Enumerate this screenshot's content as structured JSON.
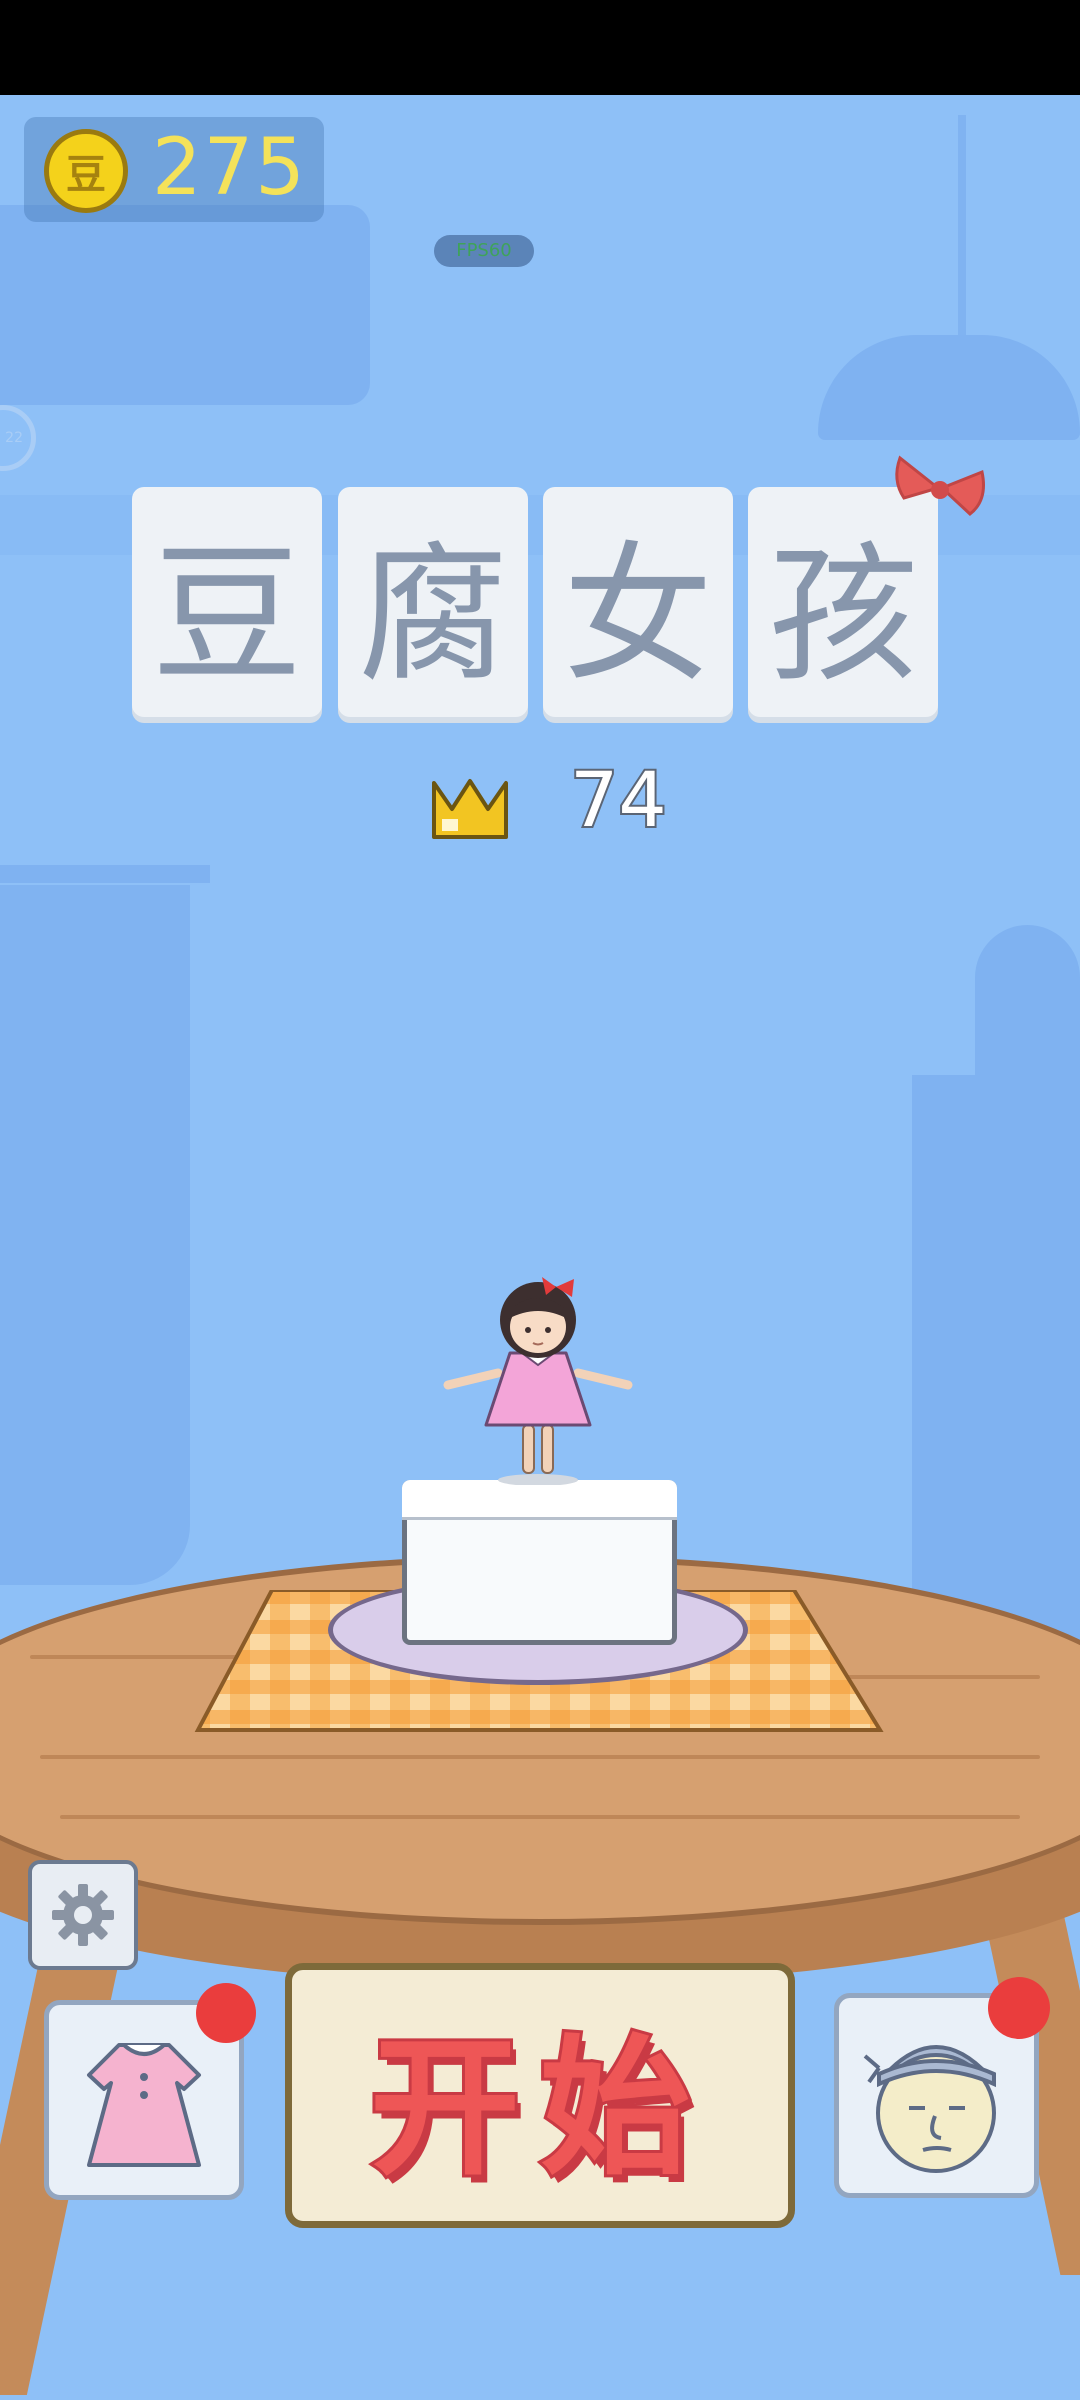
{
  "hud": {
    "coin_icon_char": "豆",
    "coins": "275",
    "fps": "FPS60",
    "side_indicator": "22"
  },
  "title": {
    "chars": [
      "豆",
      "腐",
      "女",
      "孩"
    ]
  },
  "best": {
    "icon": "crown-icon",
    "score": "74"
  },
  "buttons": {
    "start_label": "开始",
    "settings_icon": "gear-icon",
    "outfit_icon": "dress-icon",
    "boss_icon": "old-man-icon"
  },
  "colors": {
    "background": "#8ec0f7",
    "coin": "#f4d21b",
    "start_text": "#ee5656",
    "notification": "#ea3d3d"
  }
}
